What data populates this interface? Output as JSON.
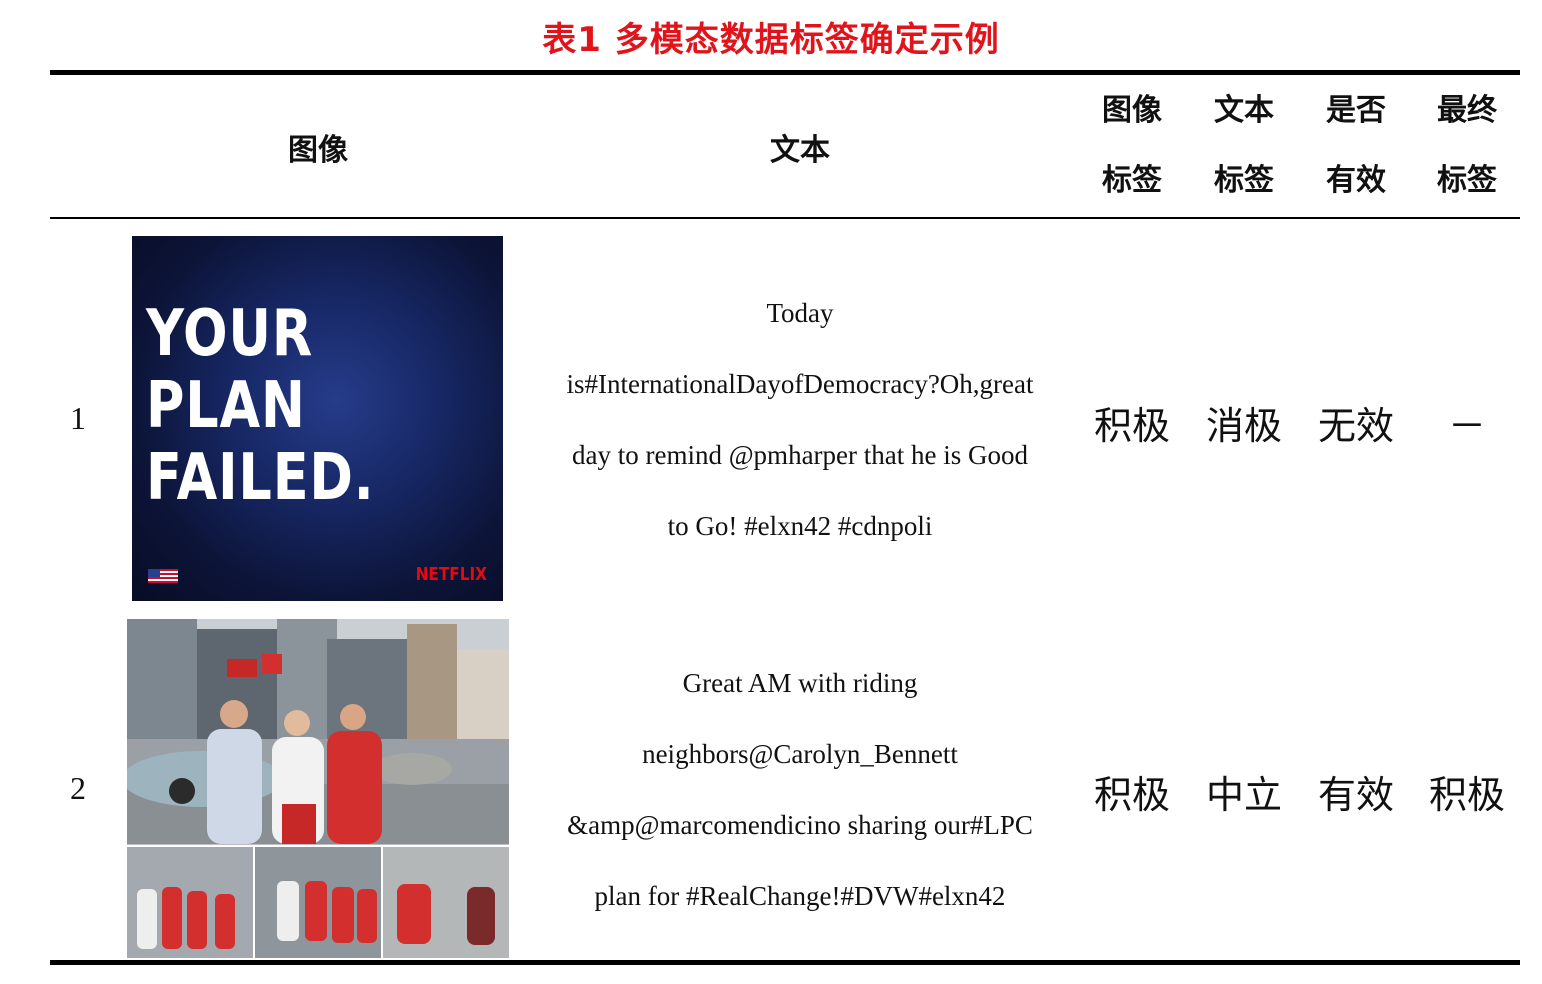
{
  "caption": "表1  多模态数据标签确定示例",
  "header": {
    "image": "图像",
    "text": "文本",
    "image_label": [
      "图像",
      "标签"
    ],
    "text_label": [
      "文本",
      "标签"
    ],
    "valid": [
      "是否",
      "有效"
    ],
    "final_label": [
      "最终",
      "标签"
    ]
  },
  "rows": [
    {
      "number": "1",
      "picture": {
        "lines": [
          "YOUR",
          "PLAN",
          "FAILED."
        ],
        "brand": "NETFLIX"
      },
      "text_lines": [
        "Today",
        "is#InternationalDayofDemocracy?Oh,great",
        "day to remind @pmharper that he is Good",
        "to Go! #elxn42 #cdnpoli"
      ],
      "image_label": "积极",
      "text_label": "消极",
      "valid": "无效",
      "final_label": "－"
    },
    {
      "number": "2",
      "text_lines": [
        "Great AM with riding",
        "neighbors@Carolyn_Bennett",
        "&amp@marcomendicino sharing our#LPC",
        "plan for #RealChange!#DVW#elxn42"
      ],
      "image_label": "积极",
      "text_label": "中立",
      "valid": "有效",
      "final_label": "积极"
    }
  ],
  "colors": {
    "caption": "#e1141c",
    "rules": "#000000"
  }
}
